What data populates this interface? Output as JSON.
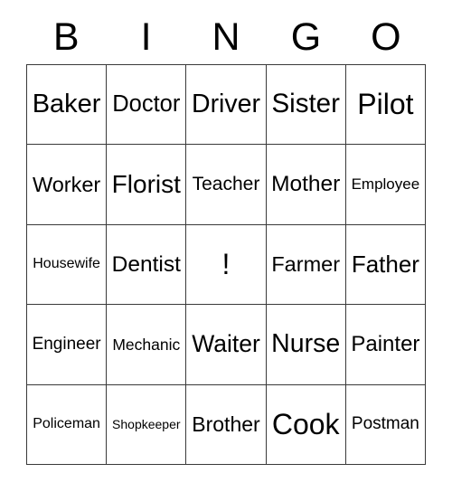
{
  "card": {
    "title": "BINGO",
    "header_letters": [
      "B",
      "I",
      "N",
      "G",
      "O"
    ],
    "free_space_marker": "!",
    "colors": {
      "background": "#ffffff",
      "grid_line": "#3a3a3a",
      "text": "#000000"
    },
    "grid": {
      "columns": 5,
      "rows": 5,
      "cells": [
        [
          {
            "label": "Baker"
          },
          {
            "label": "Doctor"
          },
          {
            "label": "Driver"
          },
          {
            "label": "Sister"
          },
          {
            "label": "Pilot"
          }
        ],
        [
          {
            "label": "Worker"
          },
          {
            "label": "Florist"
          },
          {
            "label": "Teacher"
          },
          {
            "label": "Mother"
          },
          {
            "label": "Employee"
          }
        ],
        [
          {
            "label": "Housewife"
          },
          {
            "label": "Dentist"
          },
          {
            "label": "!"
          },
          {
            "label": "Farmer"
          },
          {
            "label": "Father"
          }
        ],
        [
          {
            "label": "Engineer"
          },
          {
            "label": "Mechanic"
          },
          {
            "label": "Waiter"
          },
          {
            "label": "Nurse"
          },
          {
            "label": "Painter"
          }
        ],
        [
          {
            "label": "Policeman"
          },
          {
            "label": "Shopkeeper"
          },
          {
            "label": "Brother"
          },
          {
            "label": "Cook"
          },
          {
            "label": "Postman"
          }
        ]
      ]
    }
  }
}
